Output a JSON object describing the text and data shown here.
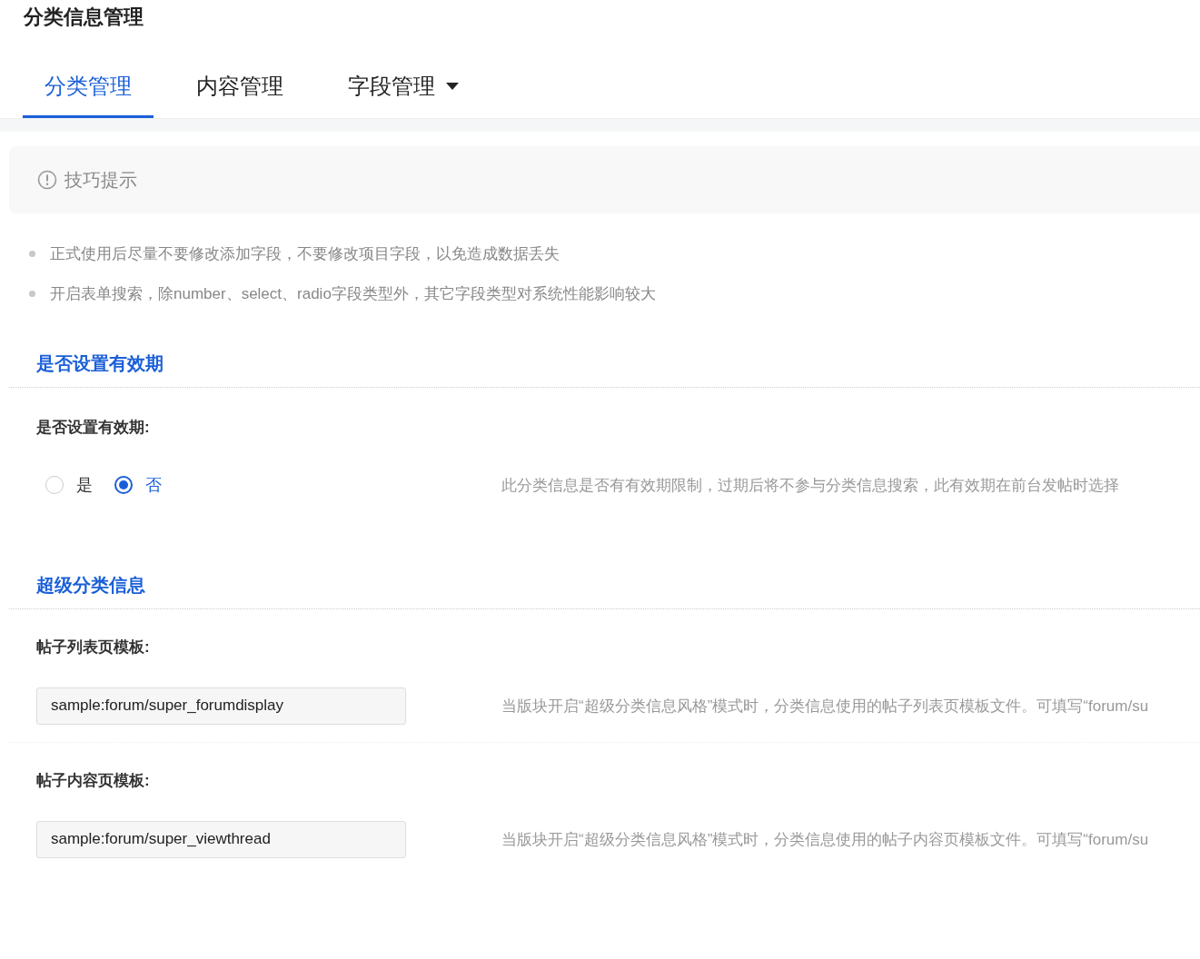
{
  "page_title": "分类信息管理",
  "tabs": [
    {
      "label": "分类管理",
      "selected": true,
      "dropdown": false
    },
    {
      "label": "内容管理",
      "selected": false,
      "dropdown": false
    },
    {
      "label": "字段管理",
      "selected": false,
      "dropdown": true
    }
  ],
  "tips": {
    "title": "技巧提示",
    "items": [
      "正式使用后尽量不要修改添加字段，不要修改项目字段，以免造成数据丢失",
      "开启表单搜索，除number、select、radio字段类型外，其它字段类型对系统性能影响较大"
    ]
  },
  "sections": [
    {
      "title": "是否设置有效期",
      "fields": [
        {
          "kind": "radio",
          "label": "是否设置有效期:",
          "options": [
            {
              "label": "是",
              "selected": false
            },
            {
              "label": "否",
              "selected": true
            }
          ],
          "description": "此分类信息是否有有效期限制，过期后将不参与分类信息搜索，此有效期在前台发帖时选择"
        }
      ]
    },
    {
      "title": "超级分类信息",
      "fields": [
        {
          "kind": "text",
          "label": "帖子列表页模板:",
          "value": "sample:forum/super_forumdisplay",
          "description": "当版块开启“超级分类信息风格”模式时，分类信息使用的帖子列表页模板文件。可填写“forum/su"
        },
        {
          "kind": "text",
          "label": "帖子内容页模板:",
          "value": "sample:forum/super_viewthread",
          "description": "当版块开启“超级分类信息风格”模式时，分类信息使用的帖子内容页模板文件。可填写“forum/su"
        }
      ]
    }
  ]
}
